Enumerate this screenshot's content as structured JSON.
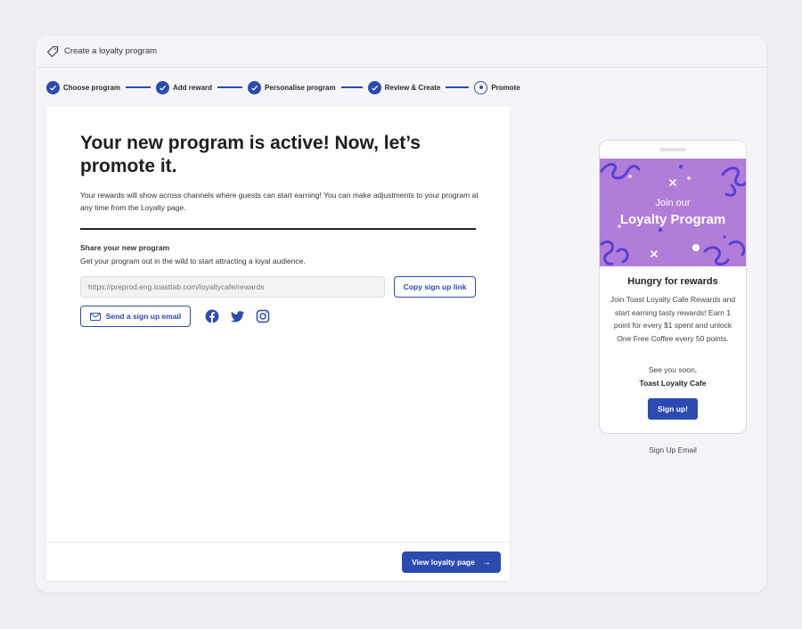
{
  "window": {
    "title": "Create a loyalty program"
  },
  "stepper": {
    "steps": [
      {
        "label": "Choose program",
        "state": "complete"
      },
      {
        "label": "Add reward",
        "state": "complete"
      },
      {
        "label": "Personalise program",
        "state": "complete"
      },
      {
        "label": "Review & Create",
        "state": "complete"
      },
      {
        "label": "Promote",
        "state": "current"
      }
    ]
  },
  "main": {
    "heading": "Your new program is active! Now, let’s promote it.",
    "description": "Your rewards will show across channels where guests can start earning! You can make adjustments to your program at any time from the Loyalty page.",
    "share": {
      "title": "Share your new program",
      "subtitle": "Get your program out in the wild to start attracting a loyal audience.",
      "url_value": "https://preprod.eng.toasttab.com/loyaltycafe/rewards",
      "copy_label": "Copy sign up link",
      "email_label": "Send a sign up email",
      "social_icons": [
        "facebook-icon",
        "twitter-icon",
        "instagram-icon"
      ]
    },
    "footer": {
      "primary_label": "View loyalty page"
    }
  },
  "preview": {
    "hero_sub": "Join our",
    "hero_title": "Loyalty Program",
    "heading": "Hungry for rewards",
    "body": "Join Toast Loyalty Cafe Rewards and start earning tasty rewards! Earn 1 point for every $1 spent and unlock One Free Coffee every 50 points.",
    "sign_off": "See you soon,",
    "brand": "Toast Loyalty Cafe",
    "button_label": "Sign up!",
    "caption": "Sign Up Email"
  },
  "colors": {
    "primary": "#2b4bb0",
    "hero_bg": "#b07ed9",
    "hero_accent": "#5a3fd6",
    "page_bg": "#eeedf2"
  }
}
